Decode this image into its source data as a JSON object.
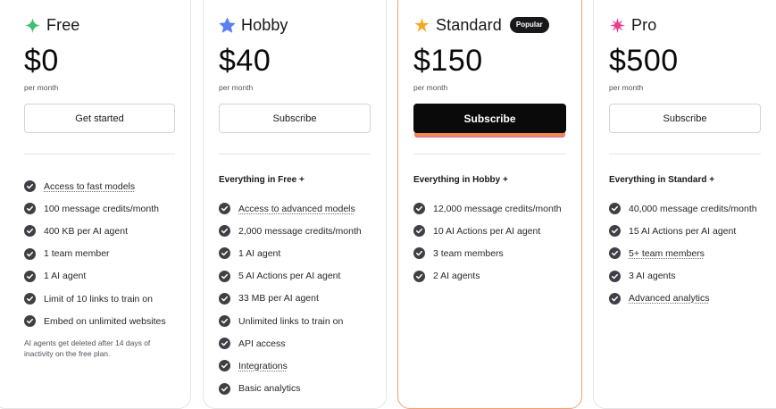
{
  "plans": [
    {
      "name": "Free",
      "icon": "sparkle-icon",
      "icon_color": "#3fbf6f",
      "price": "$0",
      "period": "per month",
      "button": "Get started",
      "features": [
        {
          "text": "Access to fast models",
          "underline": true
        },
        {
          "text": "100 message credits/month",
          "underline": false
        },
        {
          "text": "400 KB per AI agent",
          "underline": false
        },
        {
          "text": "1 team member",
          "underline": false
        },
        {
          "text": "1 AI agent",
          "underline": false
        },
        {
          "text": "Limit of 10 links to train on",
          "underline": false
        },
        {
          "text": "Embed on unlimited websites",
          "underline": false
        }
      ],
      "note": "AI agents get deleted after 14 days of inactivity on the free plan."
    },
    {
      "name": "Hobby",
      "icon": "star-icon",
      "icon_color": "#5b7ff0",
      "price": "$40",
      "period": "per month",
      "button": "Subscribe",
      "heading": "Everything in Free +",
      "features": [
        {
          "text": "Access to advanced models",
          "underline": true
        },
        {
          "text": "2,000 message credits/month",
          "underline": false
        },
        {
          "text": "1 AI agent",
          "underline": false
        },
        {
          "text": "5 AI Actions per AI agent",
          "underline": false
        },
        {
          "text": "33 MB per AI agent",
          "underline": false
        },
        {
          "text": "Unlimited links to train on",
          "underline": false
        },
        {
          "text": "API access",
          "underline": false
        },
        {
          "text": "Integrations",
          "underline": true
        },
        {
          "text": "Basic analytics",
          "underline": false
        }
      ]
    },
    {
      "name": "Standard",
      "icon": "starburst-icon",
      "icon_color": "#f5a623",
      "badge": "Popular",
      "price": "$150",
      "period": "per month",
      "button": "Subscribe",
      "heading": "Everything in Hobby +",
      "features": [
        {
          "text": "12,000 message credits/month",
          "underline": false
        },
        {
          "text": "10 AI Actions per AI agent",
          "underline": false
        },
        {
          "text": "3 team members",
          "underline": false
        },
        {
          "text": "2 AI agents",
          "underline": false
        }
      ]
    },
    {
      "name": "Pro",
      "icon": "burst-icon",
      "icon_color": "#e83e8c",
      "price": "$500",
      "period": "per month",
      "button": "Subscribe",
      "heading": "Everything in Standard +",
      "features": [
        {
          "text": "40,000 message credits/month",
          "underline": false
        },
        {
          "text": "15 AI Actions per AI agent",
          "underline": false
        },
        {
          "text": "5+ team members",
          "underline": true
        },
        {
          "text": "3 AI agents",
          "underline": false
        },
        {
          "text": "Advanced analytics",
          "underline": true
        }
      ]
    }
  ],
  "colors": {
    "check": "#3f3f46",
    "primary_button": "#0a0a0a",
    "featured_border": "#f0a070"
  }
}
